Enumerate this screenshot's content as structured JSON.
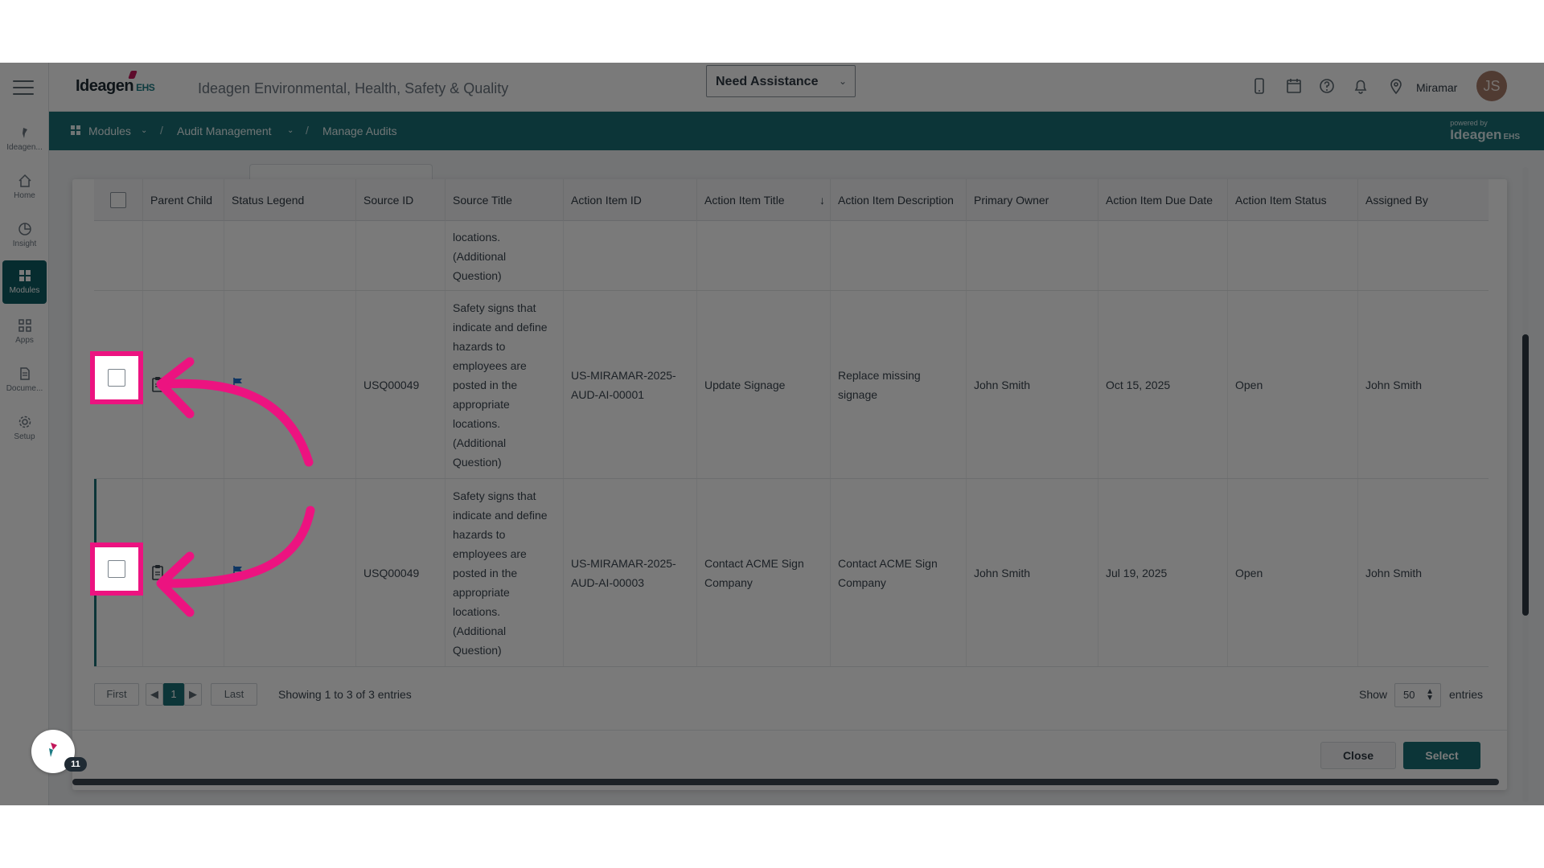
{
  "rail": {
    "items": [
      {
        "label": "Ideagen...",
        "icon": "ideagen-logo-icon"
      },
      {
        "label": "Home",
        "icon": "home-icon"
      },
      {
        "label": "Insight",
        "icon": "insight-icon"
      },
      {
        "label": "Modules",
        "icon": "modules-icon",
        "active": true
      },
      {
        "label": "Apps",
        "icon": "apps-icon"
      },
      {
        "label": "Docume...",
        "icon": "document-icon"
      },
      {
        "label": "Setup",
        "icon": "gear-icon"
      }
    ]
  },
  "header": {
    "brand": "Ideagen",
    "brand_sub": "EHS",
    "app_title": "Ideagen Environmental, Health, Safety & Quality",
    "assist_label": "Need Assistance",
    "site": "Miramar",
    "avatar_initials": "JS"
  },
  "breadcrumb": {
    "items": [
      "Modules",
      "Audit Management",
      "Manage Audits"
    ],
    "powered_by": "powered by",
    "powered_brand": "Ideagen",
    "powered_sub": "EHS"
  },
  "table": {
    "columns": [
      "",
      "Parent Child",
      "Status Legend",
      "Source ID",
      "Source Title",
      "Action Item ID",
      "Action Item Title",
      "Action Item Description",
      "Primary Owner",
      "Action Item Due Date",
      "Action Item Status",
      "Assigned By"
    ],
    "partial_row": {
      "source_title": "locations. (Additional Question)"
    },
    "rows": [
      {
        "source_id": "USQ00049",
        "source_title": "Safety signs that indicate and define hazards to employees are posted in the appropriate locations. (Additional Question)",
        "action_item_id": "US-MIRAMAR-2025-AUD-AI-00001",
        "action_item_title": "Update Signage",
        "action_item_description": "Replace missing signage",
        "primary_owner": "John Smith",
        "due_date": "Oct 15, 2025",
        "status": "Open",
        "assigned_by": "John Smith"
      },
      {
        "source_id": "USQ00049",
        "source_title": "Safety signs that indicate and define hazards to employees are posted in the appropriate locations. (Additional Question)",
        "action_item_id": "US-MIRAMAR-2025-AUD-AI-00003",
        "action_item_title": "Contact ACME Sign Company",
        "action_item_description": "Contact ACME Sign Company",
        "primary_owner": "John Smith",
        "due_date": "Jul 19, 2025",
        "status": "Open",
        "assigned_by": "John Smith"
      }
    ]
  },
  "pagination": {
    "first": "First",
    "last": "Last",
    "current_page": "1",
    "info": "Showing 1 to 3 of 3 entries",
    "show_label": "Show",
    "page_size": "50",
    "entries_label": "entries"
  },
  "footer": {
    "close_label": "Close",
    "select_label": "Select"
  },
  "help": {
    "badge": "11"
  },
  "colors": {
    "highlight": "#ec1380",
    "teal": "#1a6f75"
  }
}
